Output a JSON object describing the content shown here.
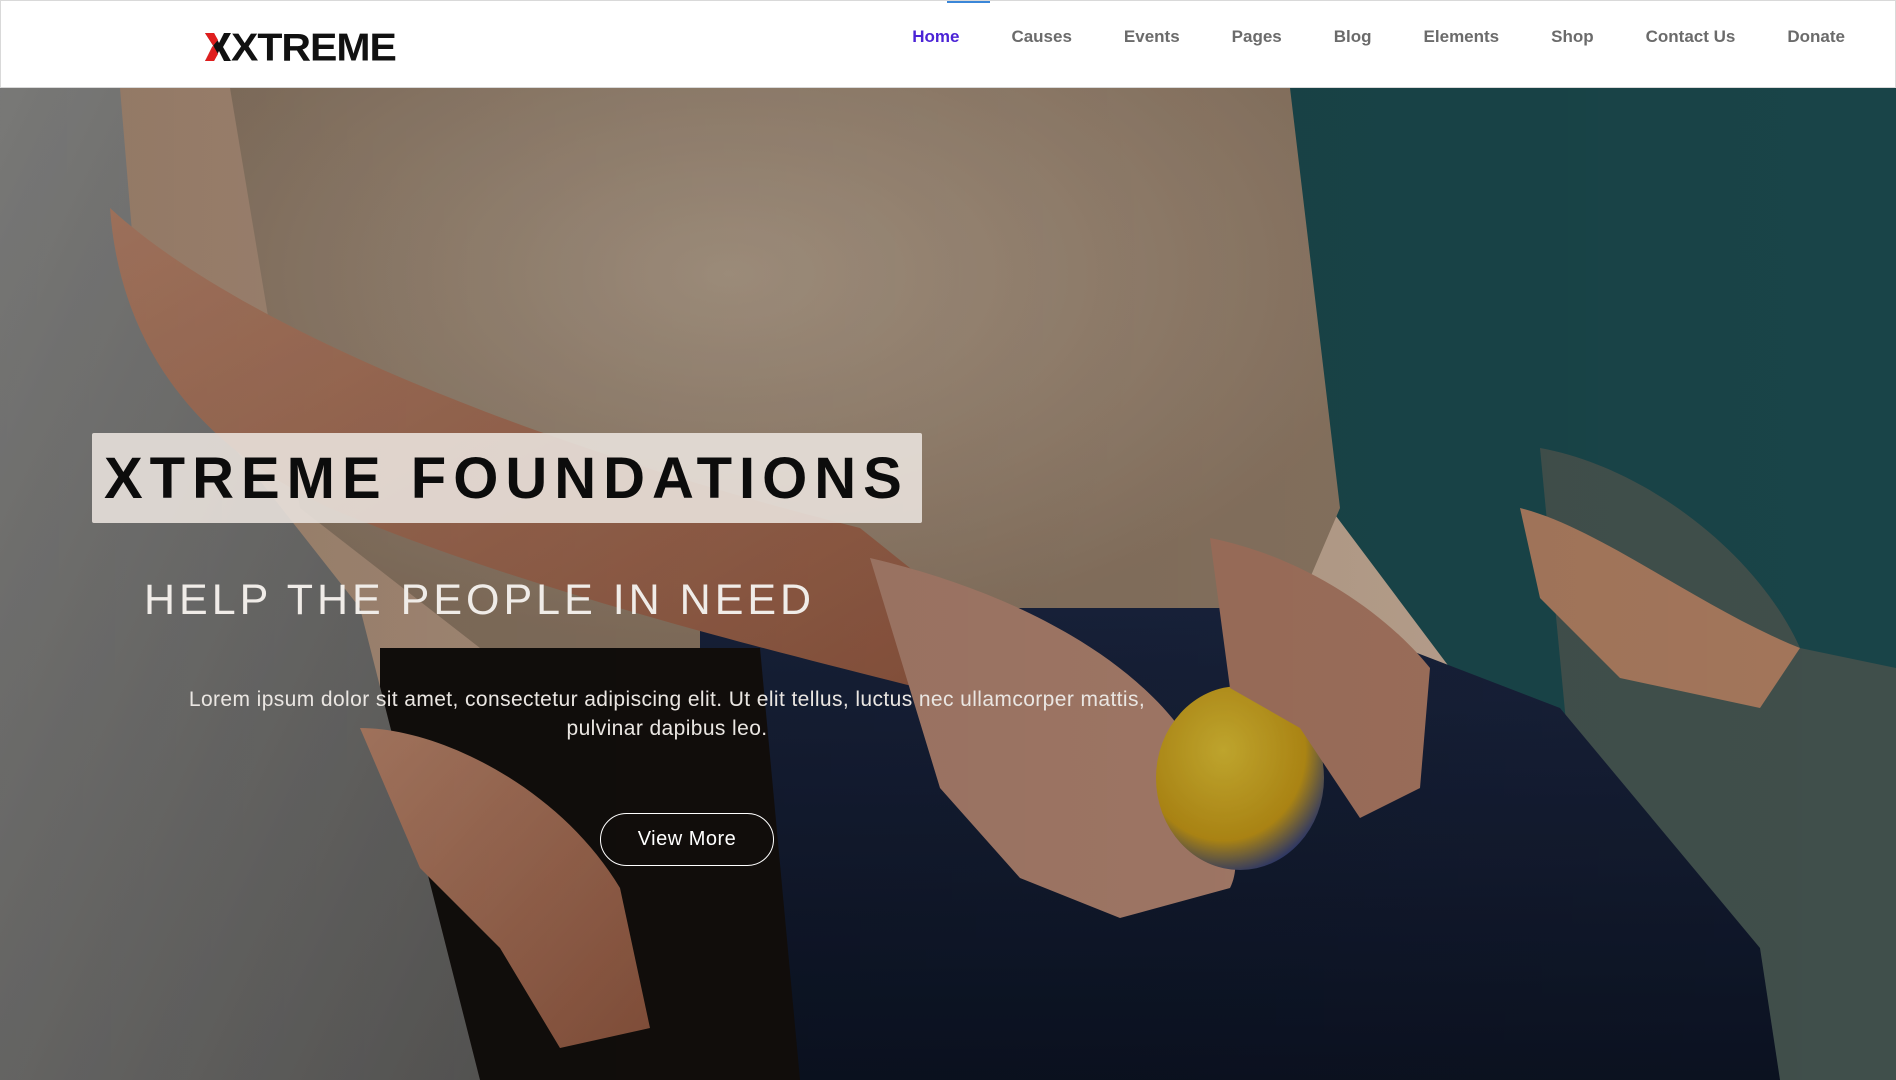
{
  "header": {
    "logo_text": "XTREME",
    "logo_accent_color": "#e01e1e",
    "nav": [
      {
        "label": "Home",
        "active": true
      },
      {
        "label": "Causes"
      },
      {
        "label": "Events"
      },
      {
        "label": "Pages"
      },
      {
        "label": "Blog"
      },
      {
        "label": "Elements"
      },
      {
        "label": "Shop"
      },
      {
        "label": "Contact Us"
      },
      {
        "label": "Donate"
      }
    ],
    "active_color": "#4b23d6",
    "indicator_color": "#3a86d8"
  },
  "hero": {
    "title": "XTREME FOUNDATIONS",
    "subtitle": "HELP THE PEOPLE IN NEED",
    "description_line1": "Lorem ipsum dolor sit amet, consectetur adipiscing elit. Ut elit tellus, luctus nec ullamcorper mattis,",
    "description_line2": "pulvinar dapibus leo.",
    "button_label": "View More",
    "background_image": "photo-caregiver-holding-elderly-hands-with-stress-ball"
  }
}
